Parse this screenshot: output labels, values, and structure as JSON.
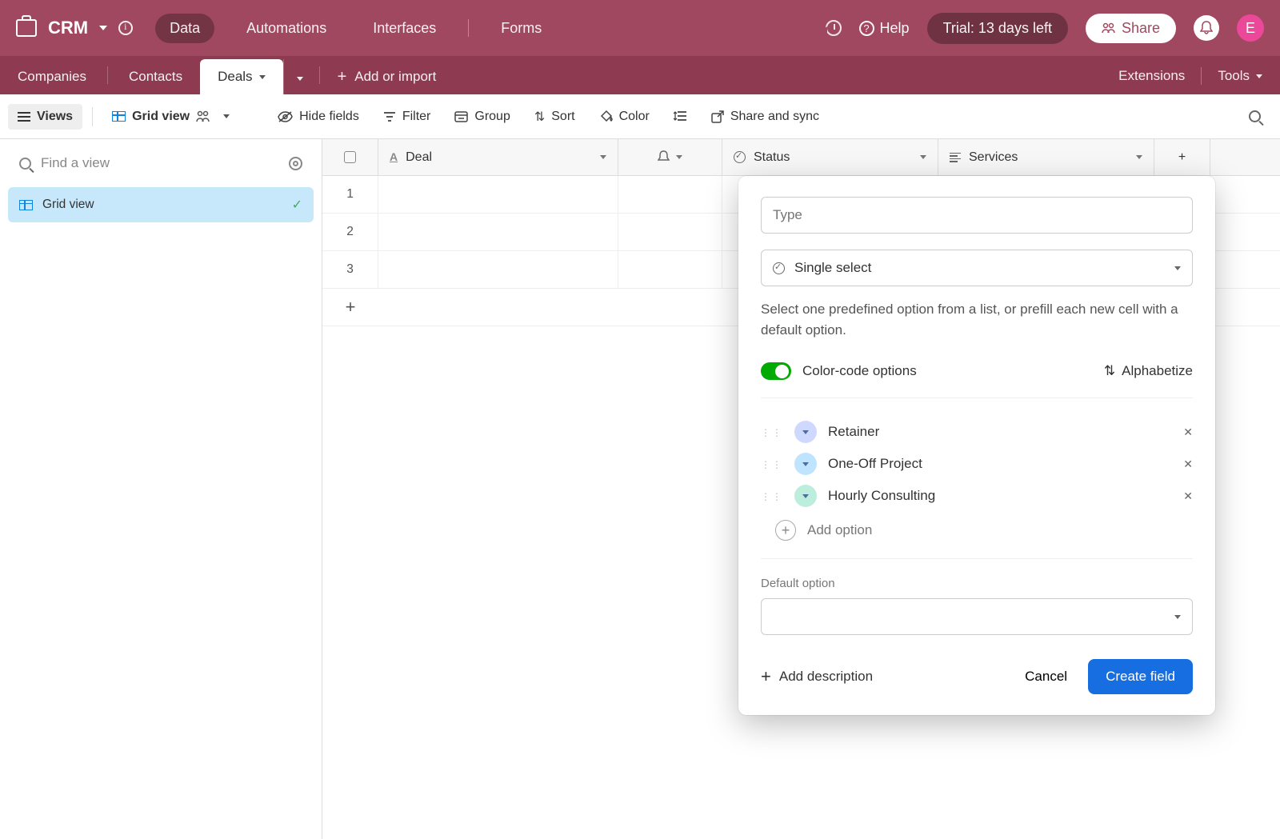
{
  "header": {
    "app_title": "CRM",
    "nav": {
      "data": "Data",
      "automations": "Automations",
      "interfaces": "Interfaces",
      "forms": "Forms"
    },
    "help": "Help",
    "trial": "Trial: 13 days left",
    "share": "Share",
    "avatar_initial": "E"
  },
  "tabs": {
    "companies": "Companies",
    "contacts": "Contacts",
    "deals": "Deals",
    "add_or_import": "Add or import",
    "extensions": "Extensions",
    "tools": "Tools"
  },
  "toolbar": {
    "views": "Views",
    "grid_view": "Grid view",
    "hide_fields": "Hide fields",
    "filter": "Filter",
    "group": "Group",
    "sort": "Sort",
    "color": "Color",
    "share_sync": "Share and sync"
  },
  "sidebar": {
    "find_placeholder": "Find a view",
    "selected_view": "Grid view"
  },
  "columns": {
    "deal": "Deal",
    "status": "Status",
    "services": "Services"
  },
  "rows": [
    "1",
    "2",
    "3"
  ],
  "popover": {
    "name_placeholder": "Type",
    "field_type": "Single select",
    "help_text": "Select one predefined option from a list, or prefill each new cell with a default option.",
    "color_code": "Color-code options",
    "alphabetize": "Alphabetize",
    "options": [
      {
        "label": "Retainer",
        "color": "#cfd9ff"
      },
      {
        "label": "One-Off Project",
        "color": "#bfe4ff"
      },
      {
        "label": "Hourly Consulting",
        "color": "#bdeedd"
      }
    ],
    "add_option": "Add option",
    "default_label": "Default option",
    "add_description": "Add description",
    "cancel": "Cancel",
    "create": "Create field"
  }
}
